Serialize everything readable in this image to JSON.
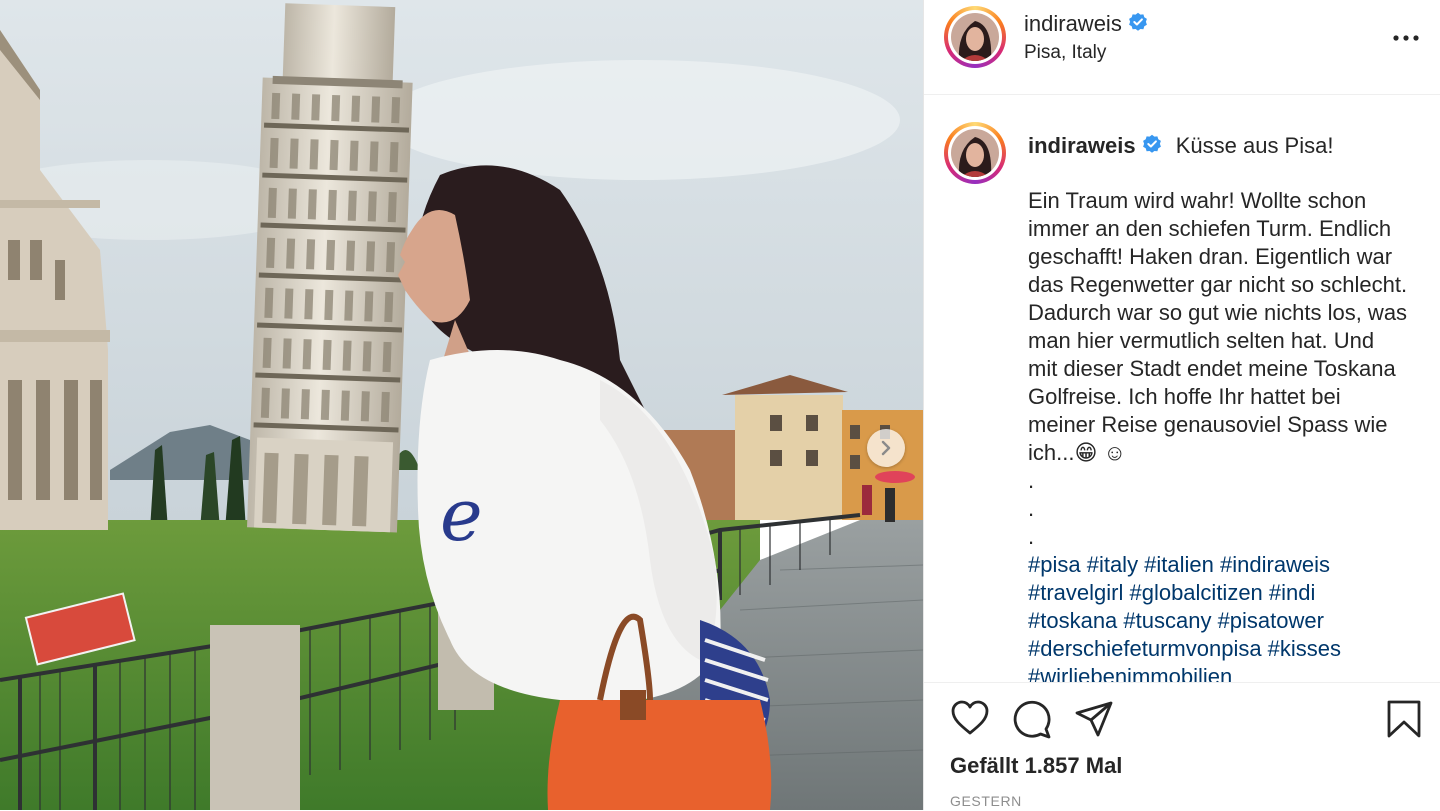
{
  "post": {
    "username": "indiraweis",
    "location": "Pisa, Italy",
    "verified": true
  },
  "caption": {
    "username": "indiraweis",
    "headline": "Küsse aus Pisa!",
    "lines": [
      "Ein Traum wird wahr! Wollte schon",
      "immer an den schiefen Turm. Endlich",
      "geschafft! Haken dran. Eigentlich war",
      "das Regenwetter gar nicht so schlecht.",
      "Dadurch war so gut wie nichts los, was",
      "man hier vermutlich selten hat. Und",
      "mit dieser Stadt endet meine Toskana",
      "Golfreise. Ich hoffe Ihr hattet bei",
      "meiner Reise genausoviel Spass wie"
    ],
    "last_line_text": "ich...",
    "last_line_emojis": "😁 ☺",
    "dots": [
      ".",
      ".",
      "."
    ],
    "hashtag_lines": [
      "#pisa #italy #italien #indiraweis",
      "#travelgirl #globalcitizen #indi",
      "#toskana #tuscany #pisatower",
      "#derschiefeturmvonpisa #kisses",
      "#wirliebenimmobilien"
    ]
  },
  "engagement": {
    "likes": "Gefällt 1.857 Mal",
    "date": "GESTERN"
  },
  "icons": {
    "verified": "verified-badge-icon",
    "more": "more-options-icon",
    "like": "heart-icon",
    "comment": "comment-icon",
    "share": "send-icon",
    "save": "bookmark-icon",
    "next": "chevron-right-icon"
  },
  "colors": {
    "verified_blue": "#3897f0",
    "hashtag": "#00376b",
    "muted": "#8e8e8e",
    "text": "#262626"
  }
}
